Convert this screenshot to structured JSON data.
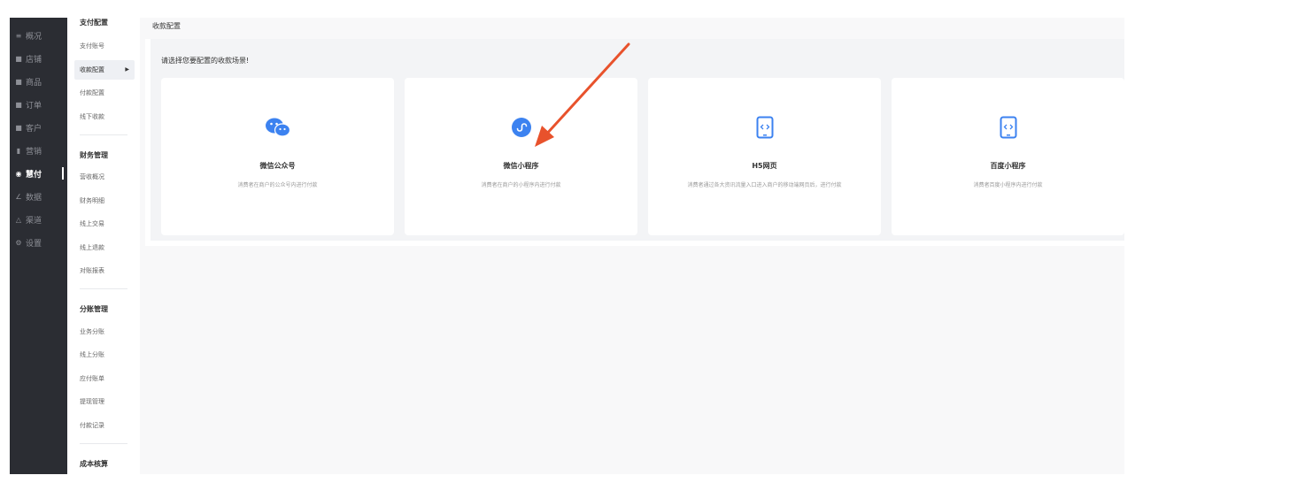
{
  "nav_primary": {
    "items": [
      {
        "icon": "menu-icon",
        "glyph": "≡",
        "label": "概况"
      },
      {
        "icon": "store-icon",
        "glyph": "■",
        "label": "店铺"
      },
      {
        "icon": "goods-icon",
        "glyph": "■",
        "label": "商品"
      },
      {
        "icon": "order-icon",
        "glyph": "■",
        "label": "订单"
      },
      {
        "icon": "customer-icon",
        "glyph": "■",
        "label": "客户"
      },
      {
        "icon": "marketing-icon",
        "glyph": "▮",
        "label": "营销"
      },
      {
        "icon": "pay-icon",
        "glyph": "◉",
        "label": "慧付",
        "active": true
      },
      {
        "icon": "data-icon",
        "glyph": "∠",
        "label": "数据"
      },
      {
        "icon": "channel-icon",
        "glyph": "△",
        "label": "渠道"
      },
      {
        "icon": "settings-icon",
        "glyph": "⚙",
        "label": "设置"
      }
    ]
  },
  "nav_secondary": {
    "group1": {
      "title": "支付配置",
      "items": [
        "支付账号",
        "收款配置",
        "付款配置",
        "线下收款"
      ],
      "active_index": 1
    },
    "group2": {
      "title": "财务管理",
      "items": [
        "营收概况",
        "财务明细",
        "线上交易",
        "线上退款",
        "对账报表"
      ]
    },
    "group3": {
      "title": "分账管理",
      "items": [
        "业务分账",
        "线上分账",
        "应付账单",
        "提现管理",
        "付款记录"
      ]
    },
    "group4": {
      "title": "成本核算"
    }
  },
  "main": {
    "title": "收款配置",
    "prompt": "请选择您要配置的收款场景!",
    "cards": [
      {
        "name": "wechat-official",
        "icon": "wechat-icon",
        "title": "微信公众号",
        "desc": "消费者在商户的公众号内进行付款"
      },
      {
        "name": "wechat-mini",
        "icon": "mini-program-icon",
        "title": "微信小程序",
        "desc": "消费者在商户的小程序内进行付款"
      },
      {
        "name": "h5",
        "icon": "h5-icon",
        "title": "H5网页",
        "desc": "消费者通过各大资讯流量入口进入商户的移动端网页后，进行付款"
      },
      {
        "name": "baidu-mini",
        "icon": "baidu-mini-icon",
        "title": "百度小程序",
        "desc": "消费者百度小程序内进行付款"
      }
    ]
  },
  "colors": {
    "accent": "#3c82f0",
    "arrow": "#e8522c",
    "sidebar": "#2b2d33"
  }
}
